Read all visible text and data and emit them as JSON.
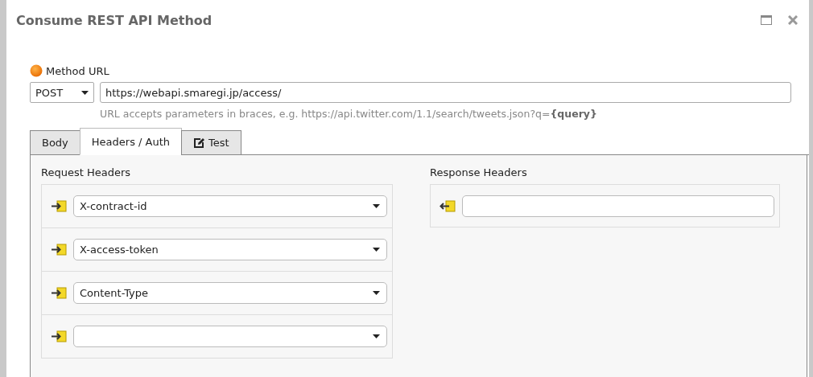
{
  "dialog": {
    "title": "Consume REST API Method"
  },
  "method_url": {
    "label": "Method URL",
    "method": "POST",
    "url": "https://webapi.smaregi.jp/access/",
    "hint": "URL accepts parameters in braces, e.g. https://api.twitter.com/1.1/search/tweets.json?q=**{query}**"
  },
  "tabs": [
    {
      "label": "Body",
      "selected": false,
      "kind": "plain"
    },
    {
      "label": "Headers / Auth",
      "selected": true,
      "kind": "plain"
    },
    {
      "label": "Test",
      "selected": false,
      "kind": "edit"
    }
  ],
  "request_headers": {
    "label": "Request Headers",
    "rows": [
      {
        "value": "X-contract-id"
      },
      {
        "value": "X-access-token"
      },
      {
        "value": "Content-Type"
      },
      {}
    ]
  },
  "response_headers": {
    "label": "Response Headers",
    "rows": [
      {}
    ]
  }
}
